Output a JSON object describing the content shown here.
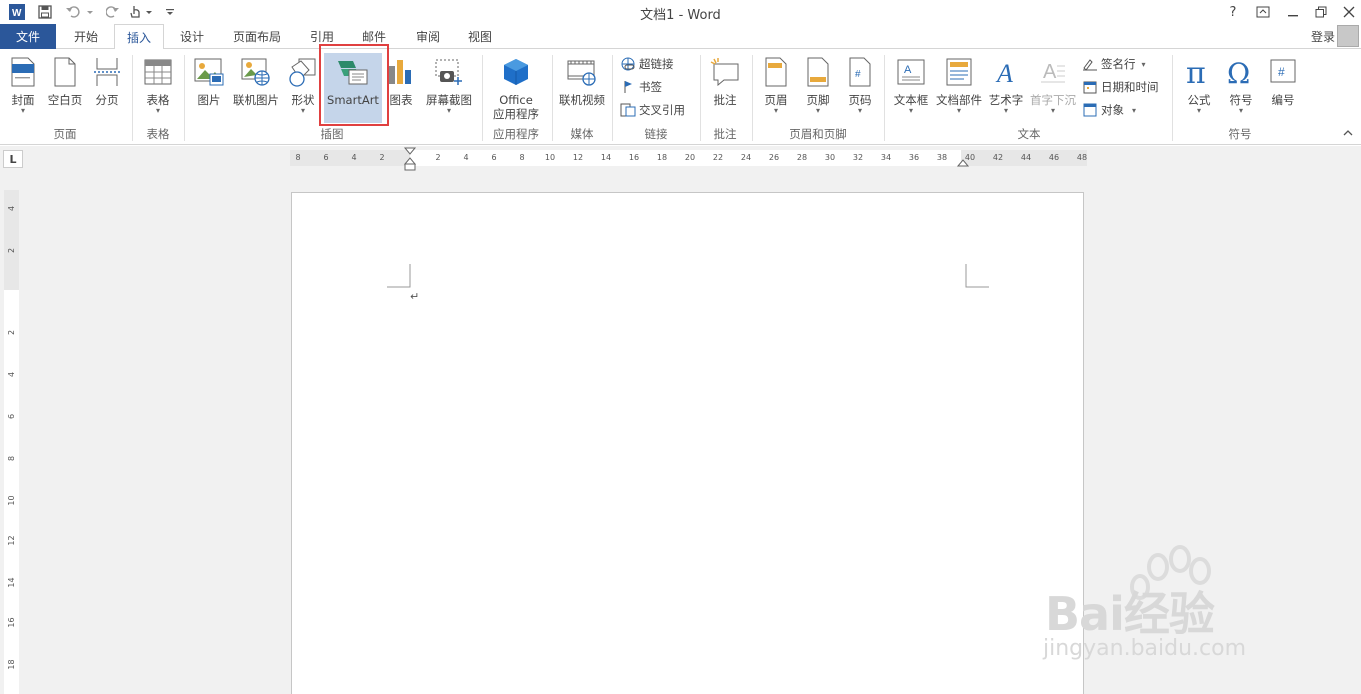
{
  "window": {
    "title": "文档1 - Word",
    "help": "?",
    "login": "登录"
  },
  "tabs": [
    {
      "label": "文件"
    },
    {
      "label": "开始"
    },
    {
      "label": "插入"
    },
    {
      "label": "设计"
    },
    {
      "label": "页面布局"
    },
    {
      "label": "引用"
    },
    {
      "label": "邮件"
    },
    {
      "label": "审阅"
    },
    {
      "label": "视图"
    }
  ],
  "ribbon": {
    "pages": {
      "cover": "封面",
      "blank": "空白页",
      "break": "分页",
      "group": "页面"
    },
    "tables": {
      "table": "表格",
      "group": "表格"
    },
    "illustrations": {
      "pictures": "图片",
      "online_pictures": "联机图片",
      "shapes": "形状",
      "smartart": "SmartArt",
      "chart": "图表",
      "screenshot": "屏幕截图",
      "group": "插图"
    },
    "apps": {
      "office_line1": "Office",
      "office_line2": "应用程序",
      "group": "应用程序"
    },
    "media": {
      "online_video": "联机视频",
      "group": "媒体"
    },
    "links": {
      "hyperlink": "超链接",
      "bookmark": "书签",
      "cross_ref": "交叉引用",
      "group": "链接"
    },
    "comments": {
      "comment": "批注",
      "group": "批注"
    },
    "header_footer": {
      "header": "页眉",
      "footer": "页脚",
      "page_number": "页码",
      "group": "页眉和页脚"
    },
    "text": {
      "textbox": "文本框",
      "quick_parts": "文档部件",
      "wordart": "艺术字",
      "dropcap": "首字下沉",
      "signature": "签名行",
      "datetime": "日期和时间",
      "object": "对象",
      "group": "文本"
    },
    "symbols": {
      "equation": "公式",
      "symbol": "符号",
      "number": "编号",
      "group": "符号"
    }
  },
  "ruler": {
    "tab_selector": "L",
    "h_ticks": [
      "8",
      "6",
      "4",
      "2",
      "2",
      "4",
      "6",
      "8",
      "10",
      "12",
      "14",
      "16",
      "18",
      "20",
      "22",
      "24",
      "26",
      "28",
      "30",
      "32",
      "34",
      "36",
      "38",
      "40",
      "42",
      "44",
      "46",
      "48"
    ],
    "v_ticks": [
      "4",
      "2",
      "2",
      "4",
      "6",
      "8",
      "10",
      "12",
      "14",
      "16",
      "18"
    ]
  },
  "document": {
    "paragraph_mark": "↵"
  },
  "watermark": {
    "brand": "Bai经验",
    "url": "jingyan.baidu.com"
  }
}
